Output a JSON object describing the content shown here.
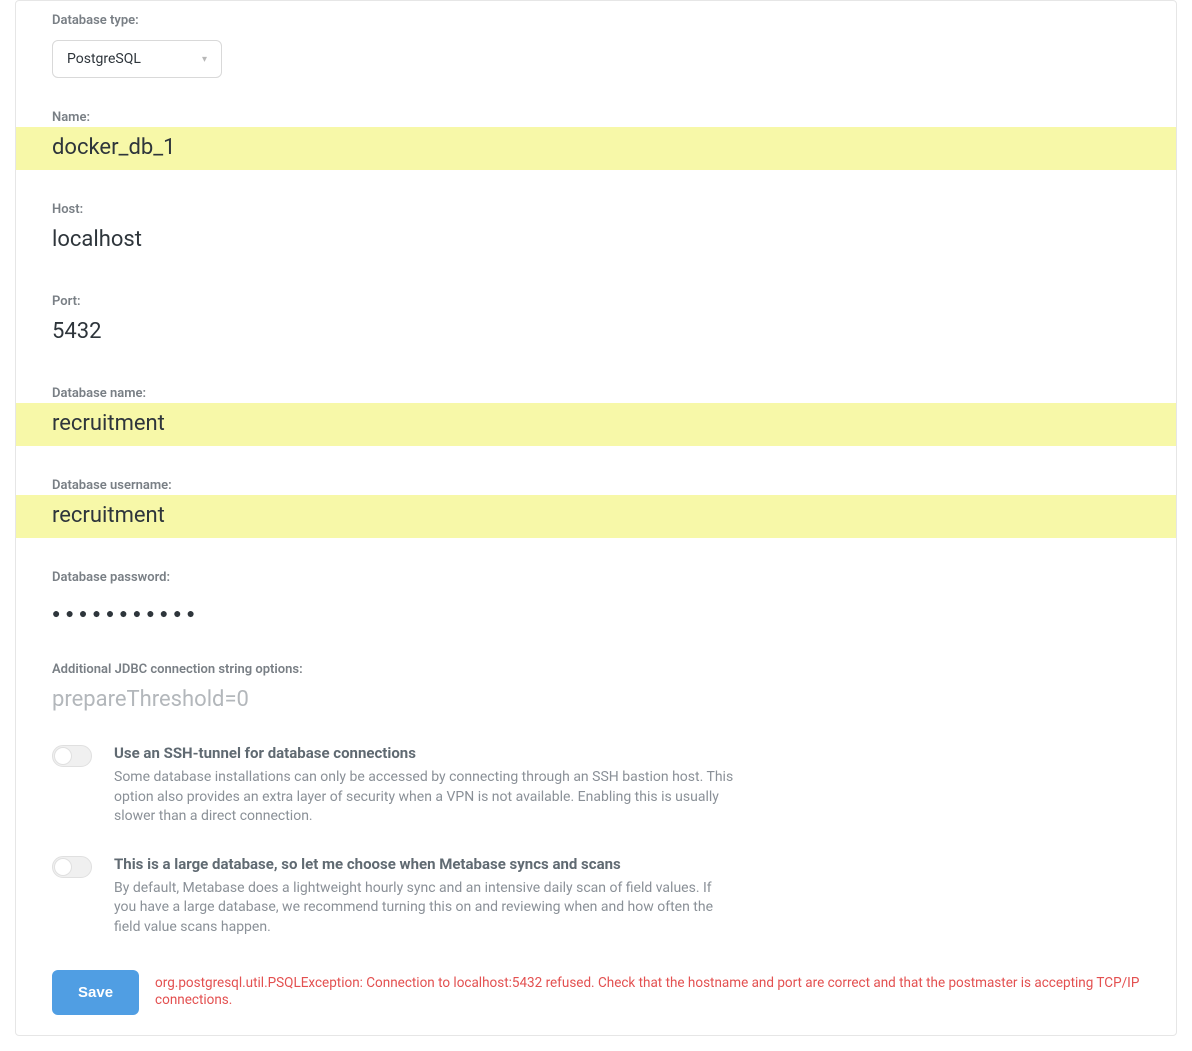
{
  "fields": {
    "database_type": {
      "label": "Database type:",
      "value": "PostgreSQL"
    },
    "name": {
      "label": "Name:",
      "value": "docker_db_1",
      "highlighted": true
    },
    "host": {
      "label": "Host:",
      "value": "localhost"
    },
    "port": {
      "label": "Port:",
      "value": "5432"
    },
    "database_name": {
      "label": "Database name:",
      "value": "recruitment",
      "highlighted": true
    },
    "database_username": {
      "label": "Database username:",
      "value": "recruitment",
      "highlighted": true
    },
    "database_password": {
      "label": "Database password:",
      "value": "●●●●●●●●●●●"
    },
    "jdbc": {
      "label": "Additional JDBC connection string options:",
      "placeholder": "prepareThreshold=0",
      "value": ""
    }
  },
  "toggles": {
    "ssh": {
      "title": "Use an SSH-tunnel for database connections",
      "desc": "Some database installations can only be accessed by connecting through an SSH bastion host. This option also provides an extra layer of security when a VPN is not available. Enabling this is usually slower than a direct connection.",
      "on": false
    },
    "large_db": {
      "title": "This is a large database, so let me choose when Metabase syncs and scans",
      "desc": "By default, Metabase does a lightweight hourly sync and an intensive daily scan of field values. If you have a large database, we recommend turning this on and reviewing when and how often the field value scans happen.",
      "on": false
    }
  },
  "footer": {
    "save_label": "Save",
    "error": "org.postgresql.util.PSQLException: Connection to localhost:5432 refused. Check that the hostname and port are correct and that the postmaster is accepting TCP/IP connections."
  }
}
